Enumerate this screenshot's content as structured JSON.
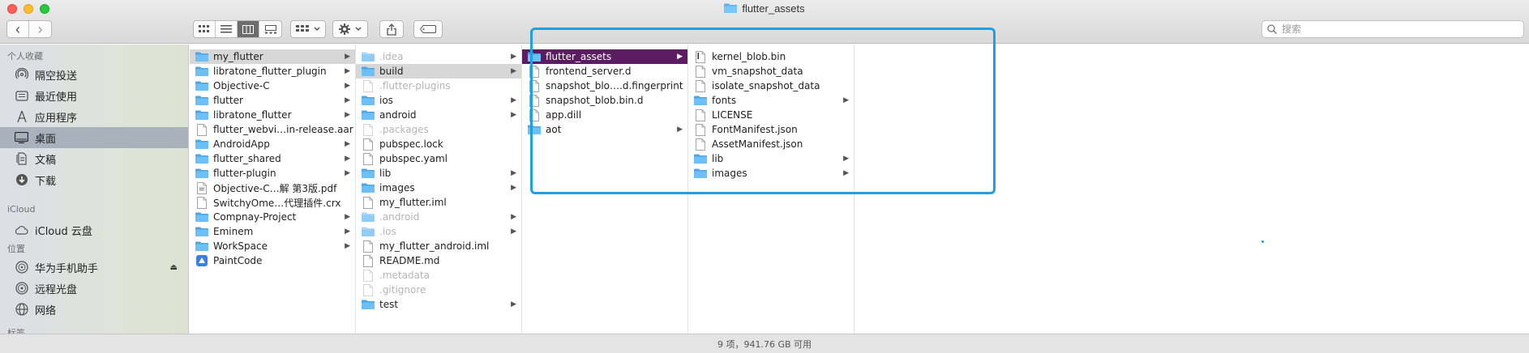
{
  "window": {
    "title": "flutter_assets"
  },
  "toolbar": {
    "back_label": "‹",
    "forward_label": "›",
    "share_label": "⇪",
    "search_placeholder": "搜索"
  },
  "sidebar": {
    "sections": [
      {
        "header": "个人收藏",
        "items": [
          {
            "label": "隔空投送",
            "icon": "airdrop-icon"
          },
          {
            "label": "最近使用",
            "icon": "recents-icon"
          },
          {
            "label": "应用程序",
            "icon": "applications-icon"
          },
          {
            "label": "桌面",
            "icon": "desktop-icon",
            "selected": true
          },
          {
            "label": "文稿",
            "icon": "documents-icon"
          },
          {
            "label": "下载",
            "icon": "downloads-icon"
          }
        ]
      },
      {
        "header": "iCloud",
        "items": [
          {
            "label": "iCloud 云盘",
            "icon": "icloud-icon"
          }
        ]
      },
      {
        "header": "位置",
        "items": [
          {
            "label": "华为手机助手",
            "icon": "disk-icon",
            "eject": true
          },
          {
            "label": "远程光盘",
            "icon": "optical-disc-icon"
          },
          {
            "label": "网络",
            "icon": "network-icon"
          }
        ]
      },
      {
        "header": "标签",
        "items": []
      }
    ]
  },
  "columns": [
    {
      "items": [
        {
          "name": "my_flutter",
          "kind": "folder",
          "chevron": true,
          "highlight": "gray"
        },
        {
          "name": "libratone_flutter_plugin",
          "kind": "folder",
          "chevron": true
        },
        {
          "name": "Objective-C",
          "kind": "folder",
          "chevron": true
        },
        {
          "name": "flutter",
          "kind": "folder",
          "chevron": true
        },
        {
          "name": "libratone_flutter",
          "kind": "folder",
          "chevron": true
        },
        {
          "name": "flutter_webvi…in-release.aar",
          "kind": "file"
        },
        {
          "name": "AndroidApp",
          "kind": "folder",
          "chevron": true
        },
        {
          "name": "flutter_shared",
          "kind": "folder",
          "chevron": true
        },
        {
          "name": "flutter-plugin",
          "kind": "folder",
          "chevron": true
        },
        {
          "name": "Objective-C…解 第3版.pdf",
          "kind": "pdf"
        },
        {
          "name": "SwitchyOme…代理插件.crx",
          "kind": "file"
        },
        {
          "name": "Compnay-Project",
          "kind": "folder",
          "chevron": true
        },
        {
          "name": "Eminem",
          "kind": "folder",
          "chevron": true
        },
        {
          "name": "WorkSpace",
          "kind": "folder",
          "chevron": true
        },
        {
          "name": "PaintCode",
          "kind": "app"
        }
      ]
    },
    {
      "items": [
        {
          "name": ".idea",
          "kind": "folder",
          "chevron": true,
          "dim": true
        },
        {
          "name": "build",
          "kind": "folder",
          "chevron": true,
          "highlight": "gray"
        },
        {
          "name": ".flutter-plugins",
          "kind": "file",
          "dim": true
        },
        {
          "name": "ios",
          "kind": "folder",
          "chevron": true
        },
        {
          "name": "android",
          "kind": "folder",
          "chevron": true
        },
        {
          "name": ".packages",
          "kind": "file",
          "dim": true
        },
        {
          "name": "pubspec.lock",
          "kind": "file"
        },
        {
          "name": "pubspec.yaml",
          "kind": "file"
        },
        {
          "name": "lib",
          "kind": "folder",
          "chevron": true
        },
        {
          "name": "images",
          "kind": "folder",
          "chevron": true
        },
        {
          "name": "my_flutter.iml",
          "kind": "file"
        },
        {
          "name": ".android",
          "kind": "folder",
          "chevron": true,
          "dim": true
        },
        {
          "name": ".ios",
          "kind": "folder",
          "chevron": true,
          "dim": true
        },
        {
          "name": "my_flutter_android.iml",
          "kind": "file"
        },
        {
          "name": "README.md",
          "kind": "file"
        },
        {
          "name": ".metadata",
          "kind": "file",
          "dim": true
        },
        {
          "name": ".gitignore",
          "kind": "file",
          "dim": true
        },
        {
          "name": "test",
          "kind": "folder",
          "chevron": true
        }
      ]
    },
    {
      "items": [
        {
          "name": "flutter_assets",
          "kind": "folder",
          "chevron": true,
          "highlight": "purple"
        },
        {
          "name": "frontend_server.d",
          "kind": "file"
        },
        {
          "name": "snapshot_blo….d.fingerprint",
          "kind": "file"
        },
        {
          "name": "snapshot_blob.bin.d",
          "kind": "file"
        },
        {
          "name": "app.dill",
          "kind": "file"
        },
        {
          "name": "aot",
          "kind": "folder",
          "chevron": true
        }
      ]
    },
    {
      "items": [
        {
          "name": "kernel_blob.bin",
          "kind": "binary"
        },
        {
          "name": "vm_snapshot_data",
          "kind": "file"
        },
        {
          "name": "isolate_snapshot_data",
          "kind": "file"
        },
        {
          "name": "fonts",
          "kind": "folder",
          "chevron": true
        },
        {
          "name": "LICENSE",
          "kind": "file"
        },
        {
          "name": "FontManifest.json",
          "kind": "file"
        },
        {
          "name": "AssetManifest.json",
          "kind": "file"
        },
        {
          "name": "lib",
          "kind": "folder",
          "chevron": true
        },
        {
          "name": "images",
          "kind": "folder",
          "chevron": true
        }
      ]
    },
    {
      "items": []
    }
  ],
  "status": {
    "text": "9 项，941.76 GB 可用"
  },
  "colors": {
    "accent": "#1ea0e5",
    "selection_purple": "#5c1c61",
    "folder_blue": "#5bb4f0"
  }
}
